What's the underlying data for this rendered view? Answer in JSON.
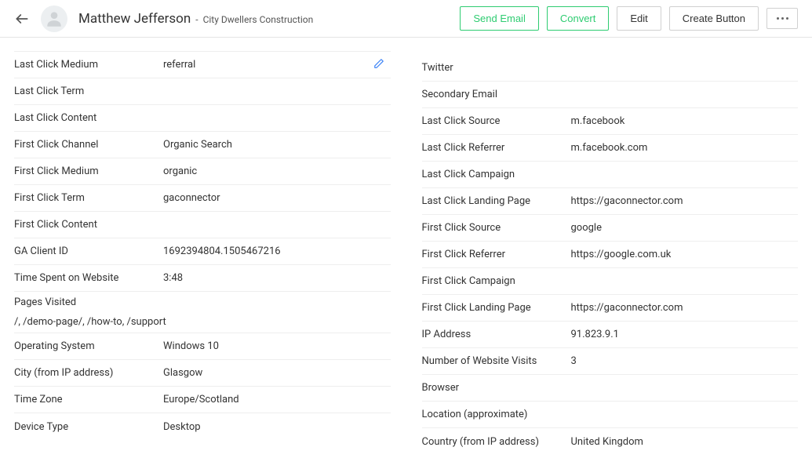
{
  "header": {
    "name": "Matthew Jefferson",
    "company": "City Dwellers Construction",
    "buttons": {
      "send_email": "Send Email",
      "convert": "Convert",
      "edit": "Edit",
      "create_button": "Create Button"
    }
  },
  "left": {
    "last_click_medium": {
      "label": "Last Click Medium",
      "value": "referral"
    },
    "last_click_term": {
      "label": "Last Click Term",
      "value": ""
    },
    "last_click_content": {
      "label": "Last Click Content",
      "value": ""
    },
    "first_click_channel": {
      "label": "First Click Channel",
      "value": "Organic Search"
    },
    "first_click_medium": {
      "label": "First Click Medium",
      "value": "organic"
    },
    "first_click_term": {
      "label": "First Click Term",
      "value": "gaconnector"
    },
    "first_click_content": {
      "label": "First Click Content",
      "value": ""
    },
    "ga_client_id": {
      "label": "GA Client ID",
      "value": "1692394804.1505467216"
    },
    "time_spent": {
      "label": "Time Spent on Website",
      "value": "3:48"
    },
    "pages_visited": {
      "label": "Pages Visited",
      "value": "/, /demo-page/, /how-to, /support"
    },
    "operating_system": {
      "label": "Operating System",
      "value": "Windows 10"
    },
    "city": {
      "label": "City (from IP address)",
      "value": "Glasgow"
    },
    "time_zone": {
      "label": "Time Zone",
      "value": "Europe/Scotland"
    },
    "device_type": {
      "label": "Device Type",
      "value": "Desktop"
    }
  },
  "right": {
    "twitter": {
      "label": "Twitter",
      "value": ""
    },
    "secondary_email": {
      "label": "Secondary Email",
      "value": ""
    },
    "last_click_source": {
      "label": "Last Click Source",
      "value": "m.facebook"
    },
    "last_click_referrer": {
      "label": "Last Click Referrer",
      "value": "m.facebook.com"
    },
    "last_click_campaign": {
      "label": "Last Click Campaign",
      "value": ""
    },
    "last_click_landing": {
      "label": "Last Click Landing Page",
      "value": "https://gaconnector.com"
    },
    "first_click_source": {
      "label": "First Click Source",
      "value": "google"
    },
    "first_click_referrer": {
      "label": "First Click Referrer",
      "value": "https://google.com.uk"
    },
    "first_click_campaign": {
      "label": "First Click Campaign",
      "value": ""
    },
    "first_click_landing": {
      "label": "First Click Landing Page",
      "value": "https://gaconnector.com"
    },
    "ip_address": {
      "label": "IP Address",
      "value": "91.823.9.1"
    },
    "visits": {
      "label": "Number of Website Visits",
      "value": "3"
    },
    "browser": {
      "label": "Browser",
      "value": ""
    },
    "location": {
      "label": "Location (approximate)",
      "value": ""
    },
    "country": {
      "label": "Country (from IP address)",
      "value": "United Kingdom"
    }
  }
}
